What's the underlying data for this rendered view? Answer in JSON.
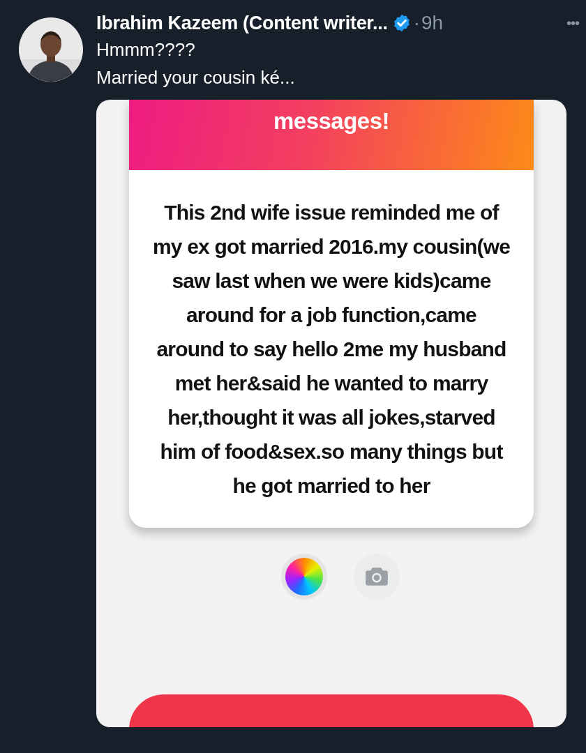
{
  "post": {
    "author": "Ibrahim Kazeem (Content writer...",
    "verified": true,
    "separator": "·",
    "time": "9h",
    "menu": "•••",
    "lines": [
      "Hmmm????",
      "Married your cousin ké..."
    ],
    "media": {
      "header_title": "messages!",
      "message": "This 2nd wife issue reminded me of my ex got married 2016.my cousin(we saw last when we were kids)came around for a job function,came around to say hello 2me my husband met her&said he wanted to marry her,thought it was all jokes,starved him of food&sex.so many things but he got married to her"
    }
  }
}
